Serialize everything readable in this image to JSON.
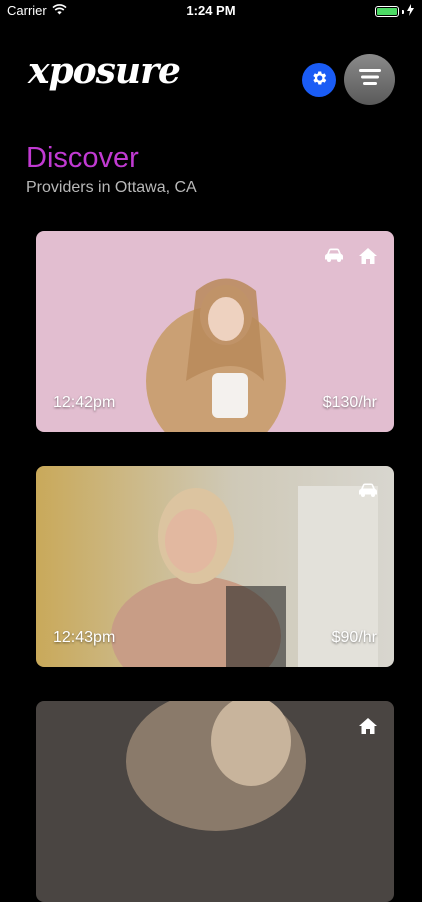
{
  "status": {
    "carrier": "Carrier",
    "time": "1:24 PM"
  },
  "app": {
    "logo": "xposure"
  },
  "header": {
    "settings_icon": "gear-icon",
    "menu_icon": "menu-icon",
    "accent_color": "#1a5cf5"
  },
  "discover": {
    "title": "Discover",
    "subtitle": "Providers in Ottawa, CA",
    "title_color": "#c13ad2"
  },
  "cards": [
    {
      "time": "12:42pm",
      "price": "$130/hr",
      "icons": [
        "car-icon",
        "home-icon"
      ]
    },
    {
      "time": "12:43pm",
      "price": "$90/hr",
      "icons": [
        "car-icon"
      ]
    },
    {
      "time": "",
      "price": "",
      "icons": [
        "home-icon"
      ]
    }
  ]
}
